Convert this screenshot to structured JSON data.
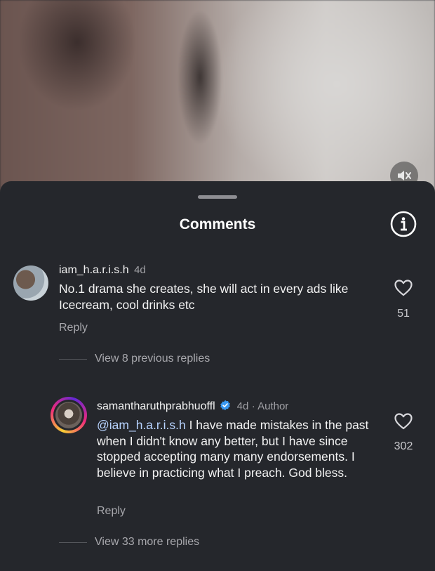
{
  "sheet": {
    "title": "Comments"
  },
  "comments": [
    {
      "username": "iam_h.a.r.i.s.h",
      "time": "4d",
      "text": "No.1 drama she creates, she will act in every ads like Icecream, cool drinks etc",
      "reply_label": "Reply",
      "likes": "51",
      "view_replies": "View 8 previous replies"
    },
    {
      "username": "samantharuthprabhuoffl",
      "time": "4d",
      "author_tag": "· Author",
      "mention": "@iam_h.a.r.i.s.h",
      "text": " I have made mistakes in the past when I didn't know any better, but I have since stopped accepting many many endorsements. I believe in practicing what I preach. God bless.",
      "reply_label": "Reply",
      "likes": "302",
      "view_replies": "View 33 more replies"
    }
  ],
  "icons": {
    "mute": "speaker-muted-icon",
    "info": "info-icon",
    "like": "heart-icon",
    "verified": "verified-badge-icon"
  },
  "colors": {
    "verified": "#3897f0",
    "mention": "#b7d3ff",
    "background": "#25272c"
  }
}
